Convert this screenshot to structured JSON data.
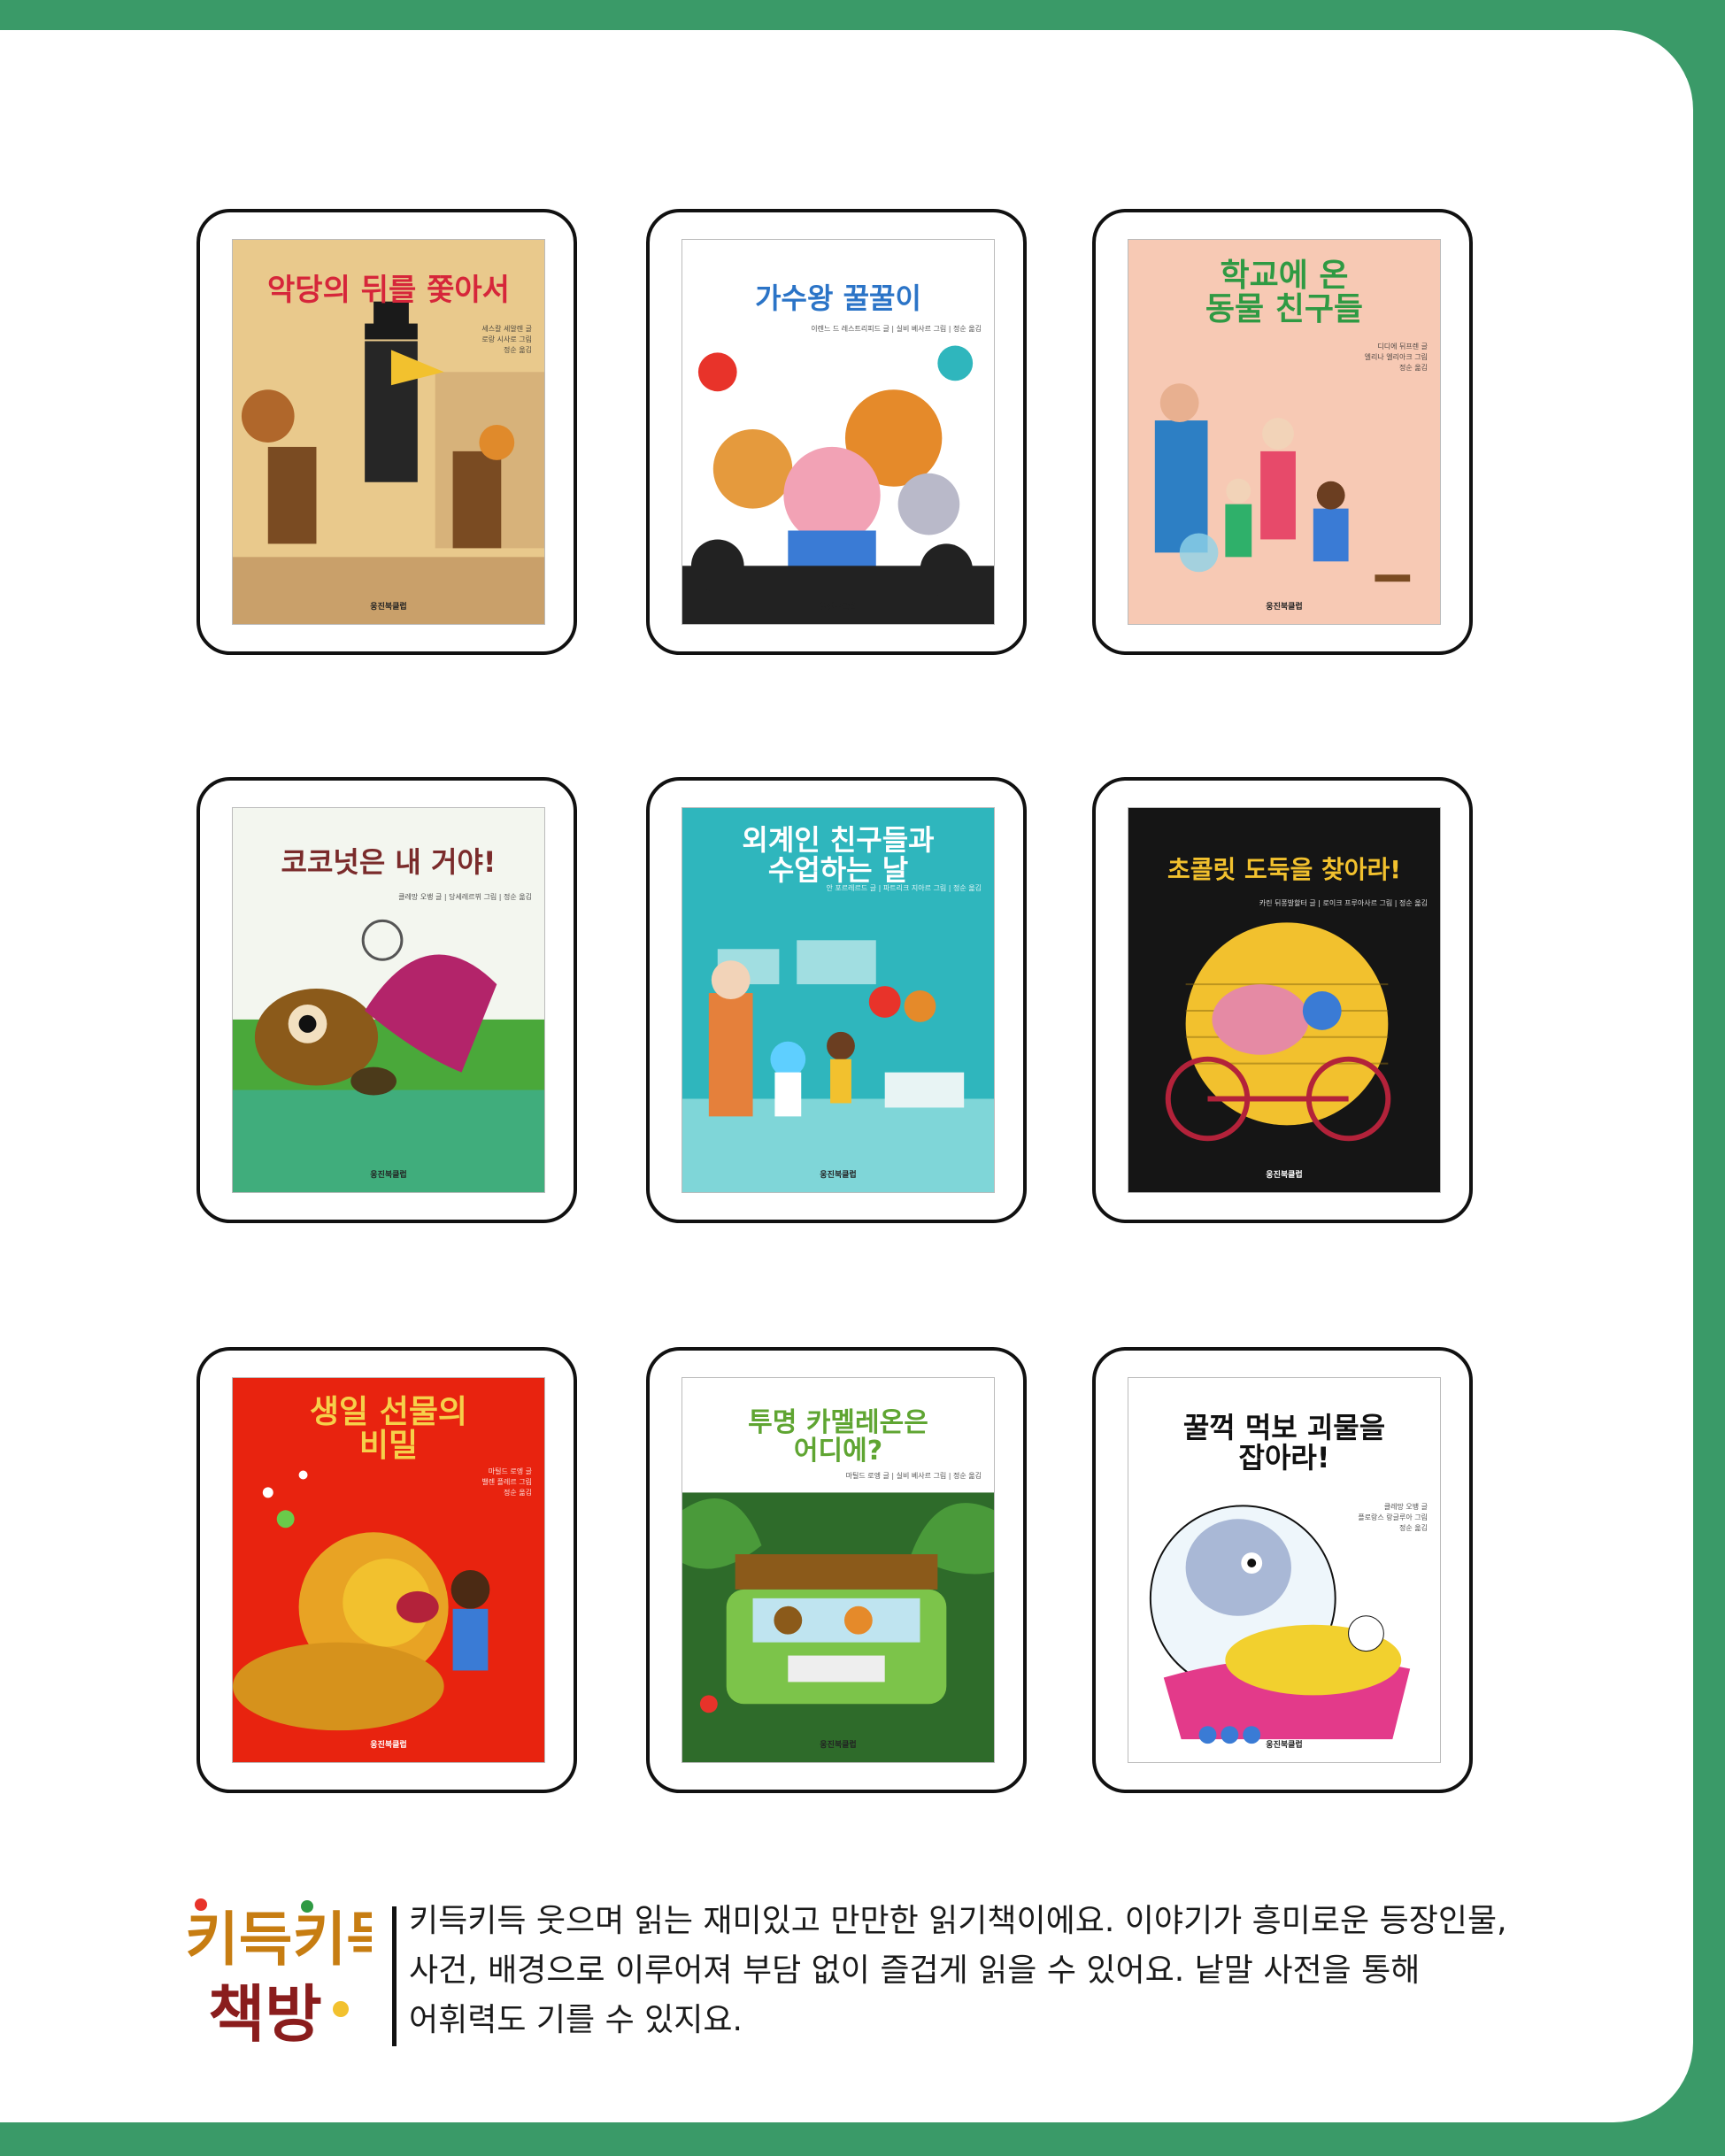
{
  "books": [
    {
      "title": "악당의 뒤를 쫓아서",
      "credit": "세스칼 세알렌 글\n로랑 시사로 그림\n정순 옮김",
      "publisher": "웅진북클럽",
      "bg": "#e9c98c",
      "title_color": "#d6263a",
      "art": "western"
    },
    {
      "title": "가수왕 꿀꿀이",
      "credit": "이렌느 드 레스트리피드 글 | 실비 베사르 그림 | 정순 옮김",
      "publisher": "웅진북클럽",
      "bg": "#ffffff",
      "title_color": "#2b74c7",
      "art": "singer"
    },
    {
      "title": "학교에 온\n동물 친구들",
      "credit": "디디에 뒤프렌 글\n엘리나 엘리아크 그림\n정순 옮김",
      "publisher": "웅진북클럽",
      "bg": "#f7c9b4",
      "title_color": "#2f9a43",
      "art": "school"
    },
    {
      "title": "코코넛은 내 거야!",
      "credit": "클레망 오뱅 글 | 당세레르뷔 그림 | 정순 옮김",
      "publisher": "웅진북클럽",
      "bg": "#f3f6ef",
      "title_color": "#7a2b2b",
      "art": "coconut"
    },
    {
      "title": "외계인 친구들과\n수업하는 날",
      "credit": "안 포르레르드 글 | 파트리크 지아르 그림 | 정순 옮김",
      "publisher": "웅진북클럽",
      "bg": "#2fb6bd",
      "title_color": "#ffffff",
      "art": "alien"
    },
    {
      "title": "초콜릿 도둑을 찾아라!",
      "credit": "카린 뒤퐁발할터 글 | 로이크 프루아사르 그림 | 정순 옮김",
      "publisher": "웅진북클럽",
      "bg": "#151515",
      "title_color": "#f2c12e",
      "art": "chocolate"
    },
    {
      "title": "생일 선물의\n비밀",
      "credit": "마틸드 로엥 글\n밸렌 플레르 그림\n정순 옮김",
      "publisher": "웅진북클럽",
      "bg": "#e8230f",
      "title_color": "#f6d04a",
      "art": "lion"
    },
    {
      "title": "투명 카멜레온은\n어디에?",
      "credit": "마틸드 로엥 글 | 실비 베사르 그림 | 정순 옮김",
      "publisher": "웅진북클럽",
      "bg": "#ffffff",
      "title_color": "#5fa532",
      "art": "jungle"
    },
    {
      "title": "꿀꺽 먹보 괴물을\n잡아라!",
      "credit": "클레망 오뱅 글\n플로랑스 랑글루아 그림\n정순 옮김",
      "publisher": "웅진북클럽",
      "bg": "#ffffff",
      "title_color": "#111111",
      "art": "monster"
    }
  ],
  "series_logo": {
    "line1": "키득키득",
    "line2": "책방"
  },
  "description": "키득키득 웃으며 읽는 재미있고 만만한 읽기책이에요. 이야기가 흥미로운 등장인물,\n사건, 배경으로 이루어져 부담 없이 즐겁게 읽을 수 있어요. 낱말 사전을 통해\n어휘력도 기를 수 있지요."
}
